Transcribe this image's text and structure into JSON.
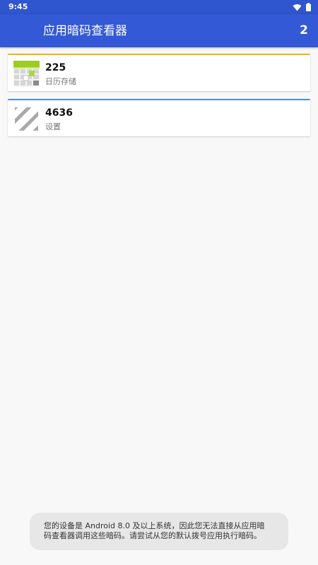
{
  "status_bar": {
    "time": "9:45",
    "icons": [
      "wifi-icon",
      "battery-icon"
    ]
  },
  "app_bar": {
    "title": "应用暗码查看器",
    "count": "2"
  },
  "codes": [
    {
      "code": "225",
      "label": "日历存储",
      "icon": "calendar-icon",
      "accent": "#f1b400"
    },
    {
      "code": "4636",
      "label": "设置",
      "icon": "striped-placeholder-icon",
      "accent": "#4a8fe0"
    }
  ],
  "toast": {
    "line1": "您的设备是 Android 8.0 及以上系统，因此您无法直接从应用暗",
    "line2": "码查看器调用这些暗码。请尝试从您的默认拨号应用执行暗码。"
  },
  "colors": {
    "app_bar": "#3359d6",
    "status_bar": "#2f55cf",
    "background": "#f8f8f8"
  }
}
